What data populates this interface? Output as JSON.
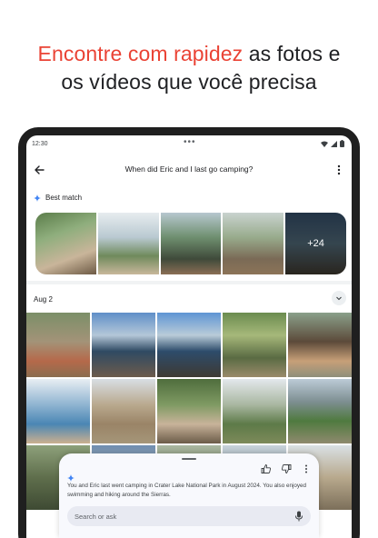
{
  "headline": {
    "line1_highlight": "Encontre com rapidez",
    "line1_rest": " as fotos e",
    "line2": "os vídeos que você precisa"
  },
  "status_bar": {
    "time": "12:30"
  },
  "app_bar": {
    "query": "When did Eric and I last go camping?"
  },
  "best_match": {
    "label": "Best match",
    "more_count": "+24"
  },
  "date_section": {
    "label": "Aug 2"
  },
  "answer_sheet": {
    "text": "You and Eric last went camping in Crater Lake National Park in August 2024. You also enjoyed swimming and hiking around the Sierras.",
    "search_placeholder": "Search or ask"
  },
  "colors": {
    "accent_red": "#ea4335",
    "spark_blue": "#4285f4",
    "device_frame": "#1f1f1f"
  }
}
